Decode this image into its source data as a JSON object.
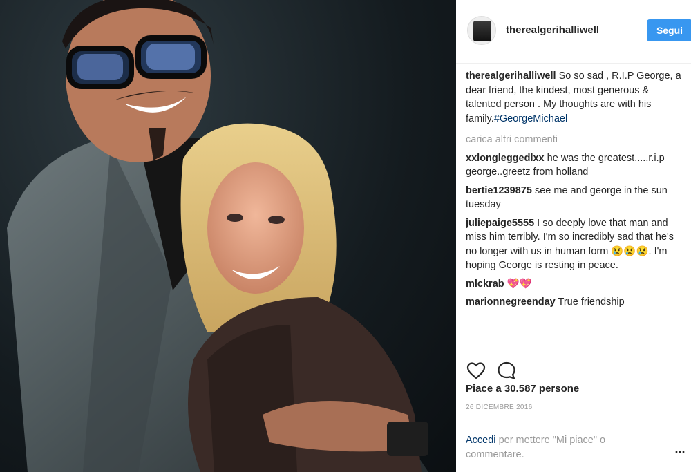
{
  "post": {
    "username": "therealgerihalliwell",
    "follow_label": "Segui",
    "caption": {
      "user": "therealgerihalliwell",
      "text": "So so sad , R.I.P George, a dear friend, the kindest, most generous & talented person . My thoughts are with his family.",
      "hashtag": "#GeorgeMichael"
    },
    "load_more": "carica altri commenti",
    "comments": [
      {
        "user": "xxlongleggedlxx",
        "text": "he was the greatest.....r.i.p george..greetz from holland"
      },
      {
        "user": "bertie1239875",
        "text": "see me and george in the sun tuesday"
      },
      {
        "user": "juliepaige5555",
        "text": "I so deeply love that man and miss him terribly. I'm so incredibly sad that he's no longer with us in human form 😢😢😢. I'm hoping George is resting in peace."
      },
      {
        "user": "mlckrab",
        "text": "💖💖"
      },
      {
        "user": "marionnegreenday",
        "text": "True friendship"
      }
    ],
    "likes": "Piace a 30.587 persone",
    "date": "26 DICEMBRE 2016",
    "login": {
      "link": "Accedi",
      "rest": "per mettere \"Mi piace\" o commentare."
    },
    "more_label": "...",
    "icons": {
      "like": "heart-outline-icon",
      "comment": "speech-bubble-icon",
      "more": "ellipsis-icon"
    },
    "colors": {
      "follow_button": "#3897f0",
      "link": "#003569",
      "muted": "#999999"
    }
  }
}
